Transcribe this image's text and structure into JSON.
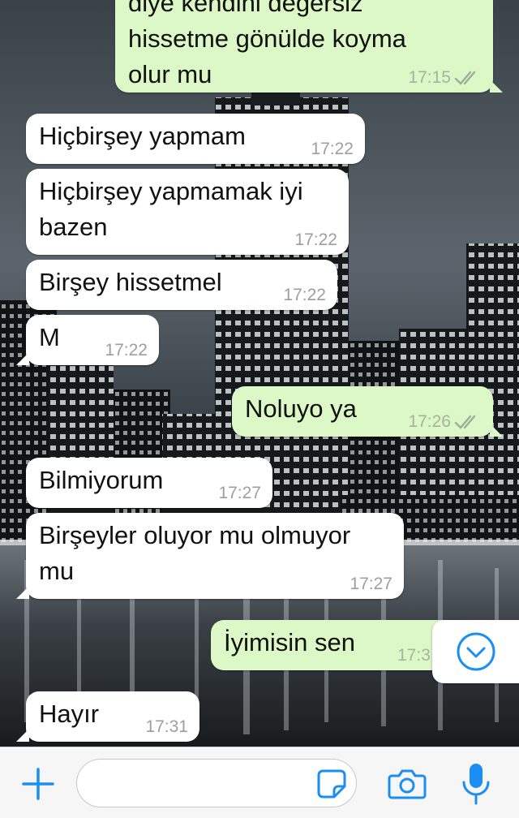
{
  "messages": [
    {
      "dir": "out",
      "lines": [
        "diye kendini değersiz",
        "hissetme gönülde koyma",
        "olur mu"
      ],
      "time": "17:15",
      "status": "read"
    },
    {
      "dir": "in",
      "lines": [
        "Hiçbirşey yapmam"
      ],
      "time": "17:22"
    },
    {
      "dir": "in",
      "lines": [
        "Hiçbirşey yapmamak iyi",
        "bazen"
      ],
      "time": "17:22"
    },
    {
      "dir": "in",
      "lines": [
        "Birşey hissetmel"
      ],
      "time": "17:22"
    },
    {
      "dir": "in",
      "lines": [
        "M"
      ],
      "time": "17:22"
    },
    {
      "dir": "out",
      "lines": [
        "Noluyo ya"
      ],
      "time": "17:26",
      "status": "read"
    },
    {
      "dir": "in",
      "lines": [
        "Bilmiyorum"
      ],
      "time": "17:27"
    },
    {
      "dir": "in",
      "lines": [
        "Birşeyler oluyor mu olmuyor",
        "mu"
      ],
      "time": "17:27"
    },
    {
      "dir": "out",
      "lines": [
        "İyimisin sen"
      ],
      "time": "17:3"
    },
    {
      "dir": "in",
      "lines": [
        "Hayır"
      ],
      "time": "17:31"
    }
  ],
  "composer": {
    "placeholder": ""
  },
  "icons": {
    "attach": "plus-icon",
    "sticker": "sticker-icon",
    "camera": "camera-icon",
    "mic": "microphone-icon",
    "scroll": "chevron-down-circle-icon",
    "read": "double-check-icon"
  },
  "colors": {
    "accent": "#1a8ef2",
    "incoming_bubble": "#ffffff",
    "outgoing_bubble": "#dcf8c6",
    "meta": "#9e9e9e"
  }
}
